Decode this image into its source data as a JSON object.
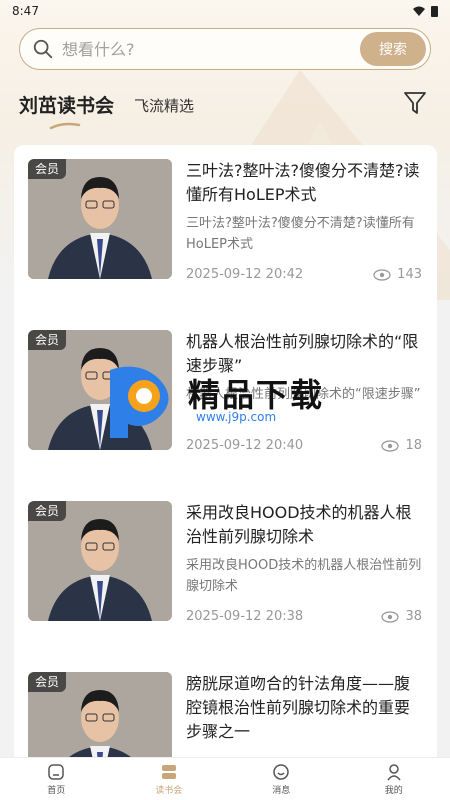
{
  "status": {
    "time": "8:47"
  },
  "search": {
    "placeholder": "想看什么?",
    "button_label": "搜索"
  },
  "tabs": [
    {
      "label": "刘茁读书会",
      "active": true
    },
    {
      "label": "飞流精选",
      "active": false
    }
  ],
  "icons": {
    "filter": "filter-icon",
    "search": "search-icon",
    "views": "eye-icon"
  },
  "items": [
    {
      "badge": "会员",
      "title": "三叶法?整叶法?傻傻分不清楚?读懂所有HoLEP术式",
      "desc": "三叶法?整叶法?傻傻分不清楚?读懂所有HoLEP术式",
      "date": "2025-09-12 20:42",
      "views": "143"
    },
    {
      "badge": "会员",
      "title": "机器人根治性前列腺切除术的“限速步骤”",
      "desc": "机器人根治性前列腺切除术的“限速步骤”",
      "date": "2025-09-12 20:40",
      "views": "18"
    },
    {
      "badge": "会员",
      "title": "采用改良HOOD技术的机器人根治性前列腺切除术",
      "desc": "采用改良HOOD技术的机器人根治性前列腺切除术",
      "date": "2025-09-12 20:38",
      "views": "38"
    },
    {
      "badge": "会员",
      "title": "膀胱尿道吻合的针法角度——腹腔镜根治性前列腺切除术的重要步骤之一",
      "desc": "",
      "date": "",
      "views": ""
    }
  ],
  "watermark": {
    "text": "精品下载",
    "url": "www.j9p.com"
  },
  "nav": [
    {
      "label": "首页",
      "icon": "home-icon",
      "active": false
    },
    {
      "label": "读书会",
      "icon": "book-icon",
      "active": true
    },
    {
      "label": "消息",
      "icon": "message-icon",
      "active": false
    },
    {
      "label": "我的",
      "icon": "profile-icon",
      "active": false
    }
  ],
  "colors": {
    "accent": "#cfb18b",
    "active_nav": "#c9a67a"
  }
}
